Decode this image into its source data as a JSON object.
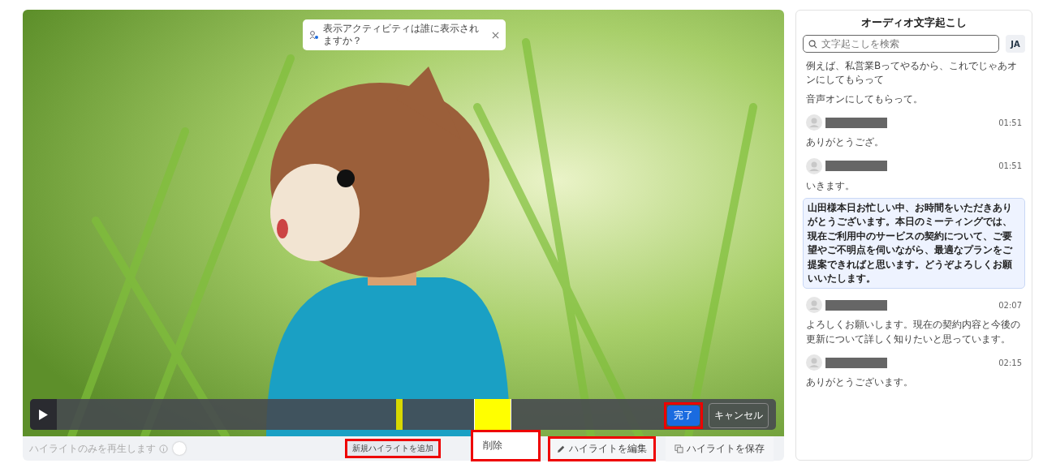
{
  "video": {
    "activity_tooltip": {
      "text": "表示アクティビティは誰に表示されますか？"
    },
    "timeline": {
      "highlights": [
        {
          "selected": false
        },
        {
          "selected": true
        }
      ],
      "done_button": {
        "label": "完了",
        "annotated": true
      },
      "cancel_button": {
        "label": "キャンセル",
        "annotated": false
      }
    }
  },
  "bottom_bar": {
    "play_highlights_only": {
      "label": "ハイライトのみを再生します",
      "on": false
    },
    "new_highlight_button": {
      "label": "新規ハイライトを追加",
      "annotated": true
    },
    "context_menu": {
      "items": [
        {
          "label": "削除"
        }
      ],
      "annotated": true
    },
    "edit_button": {
      "label": "ハイライトを編集",
      "annotated": true
    },
    "save_button": {
      "label": "ハイライトを保存",
      "annotated": false
    }
  },
  "transcript": {
    "title": "オーディオ文字起こし",
    "search": {
      "placeholder": "文字起こしを検索"
    },
    "language": "JA",
    "entries": [
      {
        "kind": "text",
        "text": "例えば、私営業Bってやるから、これでじゃあオンにしてもらって",
        "selected": false
      },
      {
        "kind": "text",
        "text": "音声オンにしてもらって。",
        "selected": false
      },
      {
        "kind": "speaker",
        "time": "01:51",
        "text": "ありがとうござ。",
        "selected": false
      },
      {
        "kind": "speaker",
        "time": "01:51",
        "text": "いきます。",
        "selected": false
      },
      {
        "kind": "text",
        "text": "山田様本日お忙しい中、お時間をいただきありがとうございます。本日のミーティングでは、現在ご利用中のサービスの契約について、ご要望やご不明点を伺いながら、最適なプランをご提案できればと思います。どうぞよろしくお願いいたします。",
        "selected": true
      },
      {
        "kind": "speaker",
        "time": "02:07",
        "text": "よろしくお願いします。現在の契約内容と今後の更新について詳しく知りたいと思っています。",
        "selected": false
      },
      {
        "kind": "speaker",
        "time": "02:15",
        "text": "ありがとうございます。",
        "selected": false
      }
    ]
  }
}
